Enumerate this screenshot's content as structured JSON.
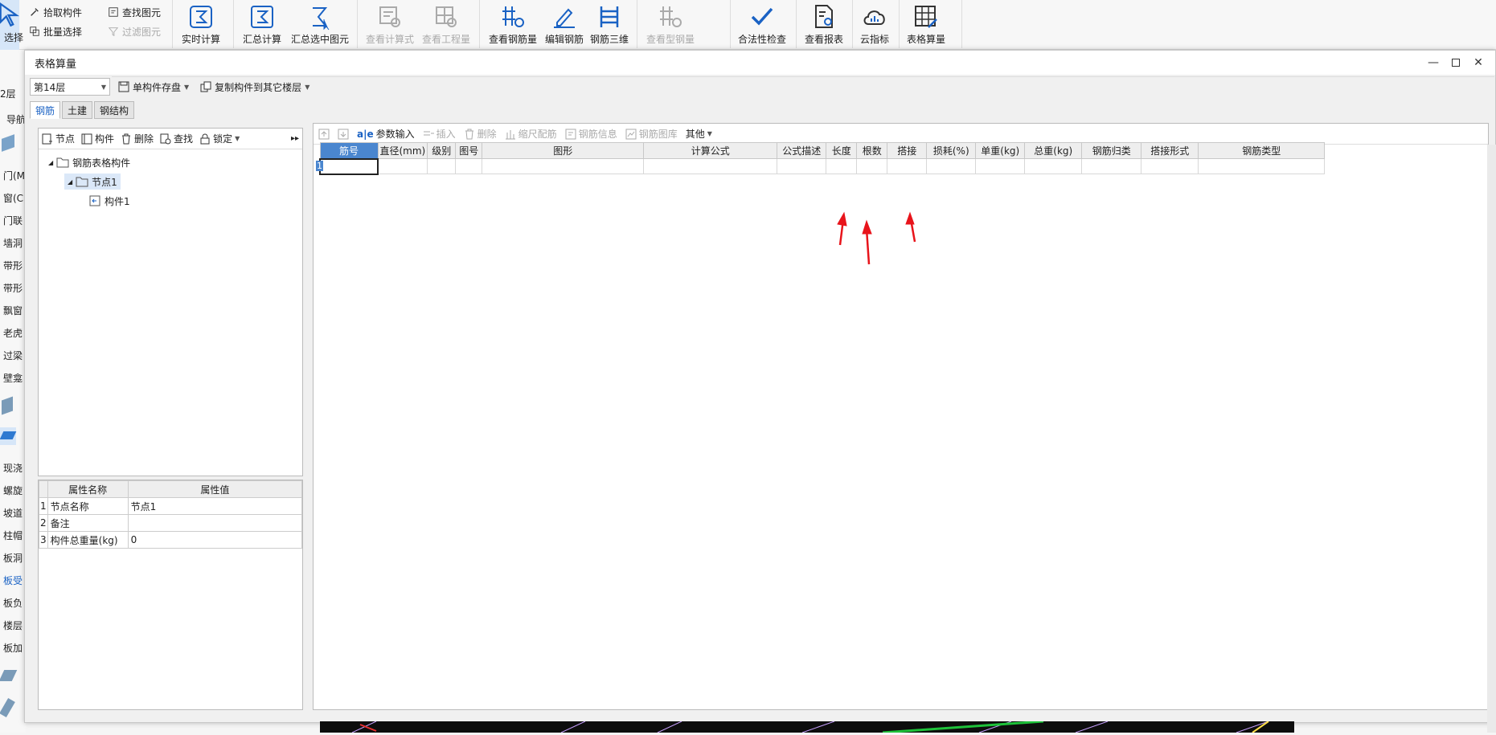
{
  "ribbon": {
    "select_label": "选择",
    "small_buttons": [
      "拾取构件",
      "批量选择",
      "查找图元",
      "过滤图元"
    ],
    "buttons": [
      {
        "label": "实时计算",
        "icon": "realtime-calc-icon",
        "enabled": true
      },
      {
        "label": "汇总计算",
        "icon": "sum-icon",
        "enabled": true
      },
      {
        "label": "汇总选中图元",
        "icon": "sum-selected-icon",
        "enabled": true
      },
      {
        "label": "查看计算式",
        "icon": "view-formula-icon",
        "enabled": false
      },
      {
        "label": "查看工程量",
        "icon": "view-quantity-icon",
        "enabled": false
      },
      {
        "label": "查看钢筋量",
        "icon": "view-rebar-icon",
        "enabled": true
      },
      {
        "label": "编辑钢筋",
        "icon": "edit-rebar-icon",
        "enabled": true
      },
      {
        "label": "钢筋三维",
        "icon": "rebar-3d-icon",
        "enabled": true
      },
      {
        "label": "查看型钢量",
        "icon": "view-steel-icon",
        "enabled": false
      },
      {
        "label": "合法性检查",
        "icon": "check-icon",
        "enabled": true
      },
      {
        "label": "查看报表",
        "icon": "report-icon",
        "enabled": true
      },
      {
        "label": "云指标",
        "icon": "cloud-icon",
        "enabled": true
      },
      {
        "label": "表格算量",
        "icon": "table-calc-icon",
        "enabled": true
      }
    ]
  },
  "left_strip": [
    "2层",
    "导航",
    "门(M",
    "窗(C",
    "门联",
    "墙洞",
    "带形",
    "带形",
    "飘窗",
    "老虎",
    "过梁",
    "壁龛",
    "现浇",
    "螺旋",
    "坡道",
    "柱帽",
    "板洞",
    "板受",
    "板负",
    "楼层",
    "板加"
  ],
  "dialog": {
    "title": "表格算量",
    "floor_select": "第14层",
    "save_label": "单构件存盘",
    "copy_label": "复制构件到其它楼层",
    "tabs": [
      "钢筋",
      "土建",
      "钢结构"
    ],
    "tree_toolbar": [
      "节点",
      "构件",
      "删除",
      "查找",
      "锁定"
    ],
    "tree": {
      "root": "钢筋表格构件",
      "node": "节点1",
      "leaf": "构件1"
    },
    "props": {
      "headers": [
        "属性名称",
        "属性值"
      ],
      "rows": [
        {
          "n": "1",
          "name": "节点名称",
          "value": "节点1"
        },
        {
          "n": "2",
          "name": "备注",
          "value": ""
        },
        {
          "n": "3",
          "name": "构件总重量(kg)",
          "value": "0"
        }
      ]
    },
    "grid_toolbar": [
      "参数输入",
      "插入",
      "删除",
      "缩尺配筋",
      "钢筋信息",
      "钢筋图库",
      "其他"
    ],
    "grid_headers": [
      "筋号",
      "直径(mm)",
      "级别",
      "图号",
      "图形",
      "计算公式",
      "公式描述",
      "长度",
      "根数",
      "搭接",
      "损耗(%)",
      "单重(kg)",
      "总重(kg)",
      "钢筋归类",
      "搭接形式",
      "钢筋类型"
    ],
    "row_number": "1"
  },
  "colors": {
    "accent": "#1a62c4",
    "header_selected": "#4a86cf",
    "arrow": "#e8141b"
  }
}
